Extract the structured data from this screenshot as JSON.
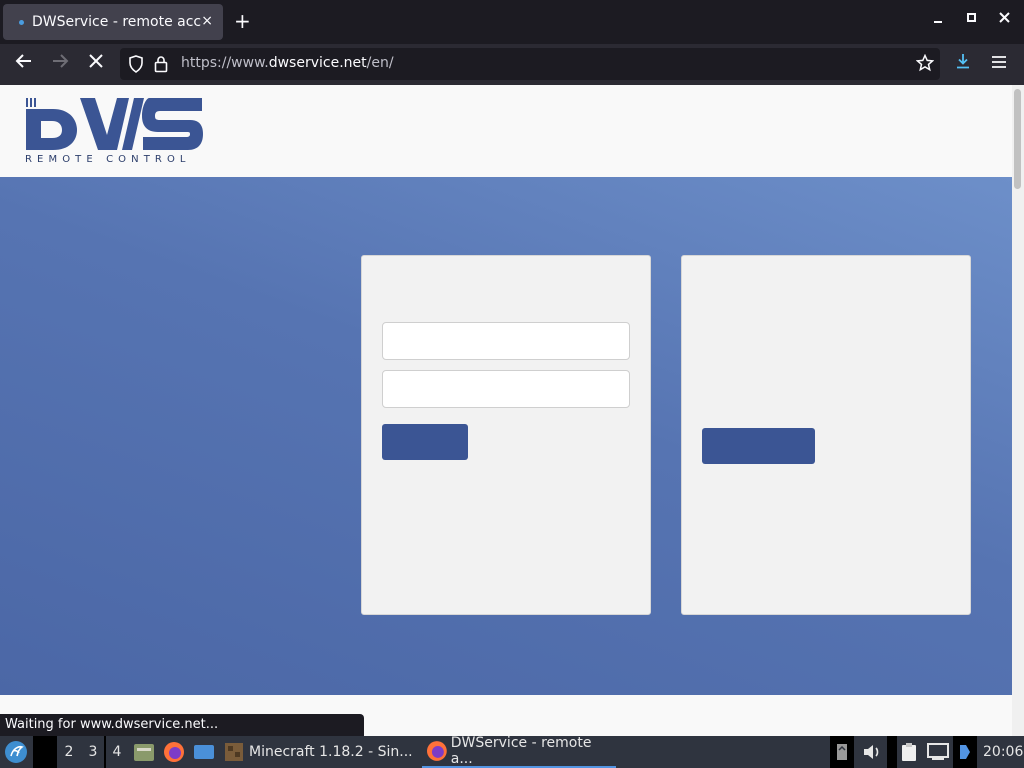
{
  "browser": {
    "tab_title": "DWService - remote access",
    "tab_close": "×",
    "new_tab": "+",
    "url_prefix": "https://www.",
    "url_domain": "dwservice.net",
    "url_path": "/en/"
  },
  "logo": {
    "letters": "DWS",
    "tagline": "REMOTE CONTROL"
  },
  "status_text": "Waiting for www.dwservice.net...",
  "taskbar": {
    "workspaces": [
      "2",
      "3",
      "4"
    ],
    "windows": [
      {
        "label": "Minecraft 1.18.2 - Sin..."
      },
      {
        "label": "DWService - remote a..."
      }
    ],
    "clock": "20:06"
  },
  "colors": {
    "brand_blue": "#3b5594",
    "hero_light": "#6d8fc9",
    "hero_dark": "#4b67a6"
  }
}
